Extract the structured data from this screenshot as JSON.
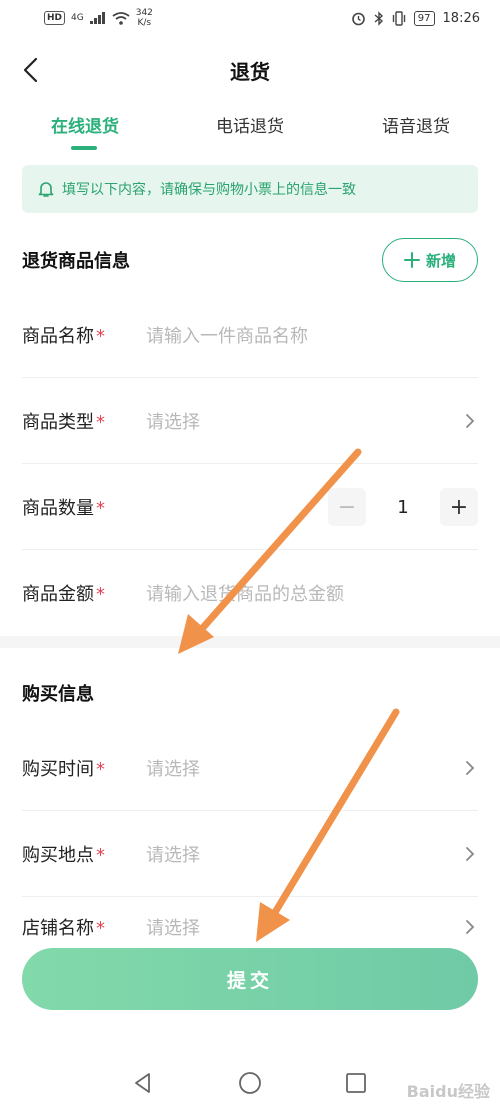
{
  "status_bar": {
    "network_badge": "HD",
    "signal_label": "4G",
    "speed_value": "342",
    "speed_unit": "K/s",
    "battery": "97",
    "time": "18:26"
  },
  "nav": {
    "title": "退货"
  },
  "tabs": [
    {
      "label": "在线退货",
      "active": true
    },
    {
      "label": "电话退货",
      "active": false
    },
    {
      "label": "语音退货",
      "active": false
    }
  ],
  "notice": {
    "text": "填写以下内容，请确保与购物小票上的信息一致"
  },
  "product_section": {
    "title": "退货商品信息",
    "add_label": "新增",
    "rows": [
      {
        "label": "商品名称",
        "required_mark": "*",
        "placeholder": "请输入一件商品名称"
      },
      {
        "label": "商品类型",
        "required_mark": "*",
        "placeholder": "请选择"
      },
      {
        "label": "商品数量",
        "required_mark": "*",
        "quantity": "1",
        "minus": "−",
        "plus": "+"
      },
      {
        "label": "商品金额",
        "required_mark": "*",
        "placeholder": "请输入退货商品的总金额"
      }
    ]
  },
  "purchase_section": {
    "title": "购买信息",
    "rows": [
      {
        "label": "购买时间",
        "required_mark": "*",
        "placeholder": "请选择"
      },
      {
        "label": "购买地点",
        "required_mark": "*",
        "placeholder": "请选择"
      },
      {
        "label": "店铺名称",
        "required_mark": "*",
        "placeholder": "请选择"
      }
    ]
  },
  "submit": {
    "label": "提交"
  },
  "watermark": {
    "text": "Baidu经验"
  },
  "colors": {
    "accent": "#2bb07c",
    "notice_bg": "#e6f6ee",
    "required": "#e0455a",
    "arrow": "#f0924a"
  }
}
